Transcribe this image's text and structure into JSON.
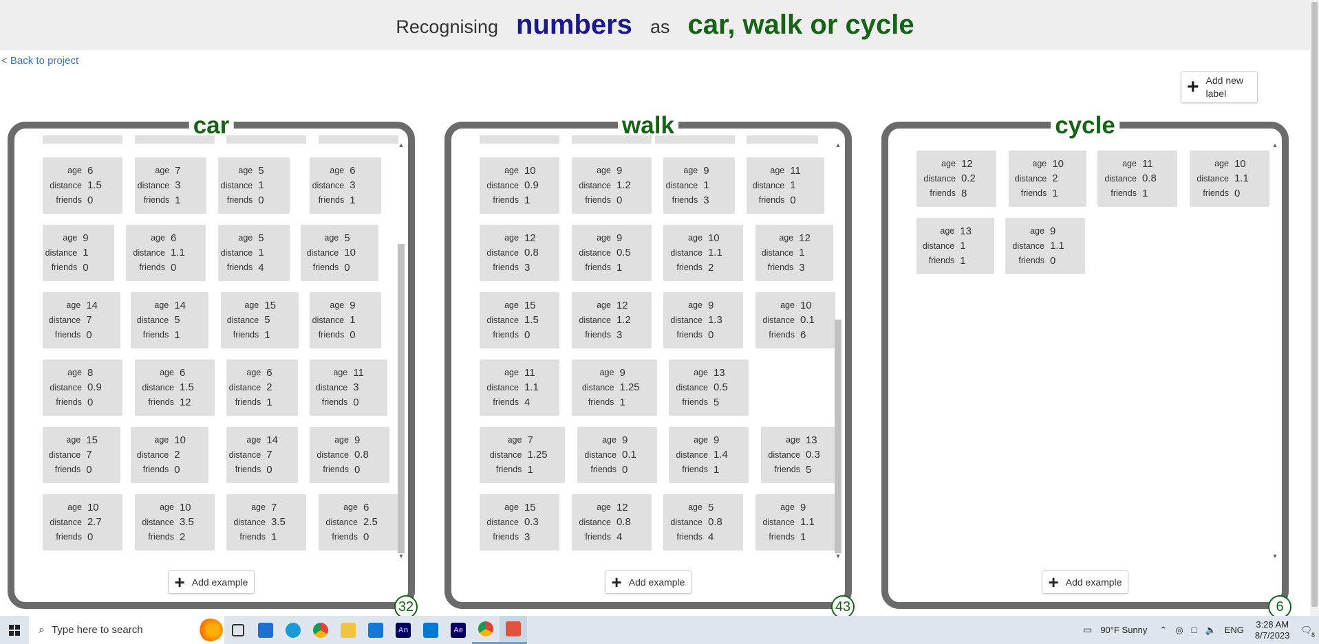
{
  "header": {
    "prefix": "Recognising",
    "type": "numbers",
    "middle": "as",
    "labels": "car, walk or cycle"
  },
  "back_link": "< Back to project",
  "add_label_button": {
    "line1": "Add new",
    "line2": "label"
  },
  "add_example_label": "Add example",
  "colors": {
    "title_green": "#166316",
    "title_blue": "#1a1a8c",
    "frame": "#6b6b6b",
    "card": "#e0e0e0"
  },
  "buckets": [
    {
      "name": "car",
      "count": "32",
      "cards": [
        [
          "6",
          "1.5",
          "0"
        ],
        [
          "7",
          "3",
          "1"
        ],
        [
          "5",
          "1",
          "0"
        ],
        [
          "6",
          "3",
          "1"
        ],
        [
          "9",
          "1",
          "0"
        ],
        [
          "6",
          "1.1",
          "0"
        ],
        [
          "5",
          "1",
          "4"
        ],
        [
          "5",
          "10",
          "0"
        ],
        [
          "14",
          "7",
          "0"
        ],
        [
          "14",
          "5",
          "1"
        ],
        [
          "15",
          "5",
          "1"
        ],
        [
          "9",
          "1",
          "0"
        ],
        [
          "8",
          "0.9",
          "0"
        ],
        [
          "6",
          "1.5",
          "12"
        ],
        [
          "6",
          "2",
          "1"
        ],
        [
          "11",
          "3",
          "0"
        ],
        [
          "15",
          "7",
          "0"
        ],
        [
          "10",
          "2",
          "0"
        ],
        [
          "14",
          "7",
          "0"
        ],
        [
          "9",
          "0.8",
          "0"
        ],
        [
          "10",
          "2.7",
          "0"
        ],
        [
          "10",
          "3.5",
          "2"
        ],
        [
          "7",
          "3.5",
          "1"
        ],
        [
          "6",
          "2.5",
          "0"
        ]
      ]
    },
    {
      "name": "walk",
      "count": "43",
      "cards": [
        [
          "10",
          "0.9",
          "1"
        ],
        [
          "9",
          "1.2",
          "0"
        ],
        [
          "9",
          "1",
          "3"
        ],
        [
          "11",
          "1",
          "0"
        ],
        [
          "12",
          "0.8",
          "3"
        ],
        [
          "9",
          "0.5",
          "1"
        ],
        [
          "10",
          "1.1",
          "2"
        ],
        [
          "12",
          "1",
          "3"
        ],
        [
          "15",
          "1.5",
          "0"
        ],
        [
          "12",
          "1.2",
          "3"
        ],
        [
          "9",
          "1.3",
          "0"
        ],
        [
          "10",
          "0.1",
          "6"
        ],
        [
          "11",
          "1.1",
          "4"
        ],
        [
          "9",
          "1.25",
          "1"
        ],
        [
          "13",
          "0.5",
          "5"
        ],
        [
          "7",
          "1.25",
          "1"
        ],
        [
          "9",
          "0.1",
          "0"
        ],
        [
          "9",
          "1.4",
          "1"
        ],
        [
          "13",
          "0.3",
          "5"
        ],
        [
          "15",
          "0.3",
          "3"
        ],
        [
          "12",
          "0.8",
          "4"
        ],
        [
          "5",
          "0.8",
          "4"
        ],
        [
          "9",
          "1.1",
          "1"
        ]
      ]
    },
    {
      "name": "cycle",
      "count": "6",
      "cards": [
        [
          "12",
          "0.2",
          "8"
        ],
        [
          "10",
          "2",
          "1"
        ],
        [
          "11",
          "0.8",
          "1"
        ],
        [
          "10",
          "1.1",
          "0"
        ],
        [
          "13",
          "1",
          "1"
        ],
        [
          "9",
          "1.1",
          "0"
        ]
      ]
    }
  ],
  "field_names": {
    "age": "age",
    "distance": "distance",
    "friends": "friends"
  },
  "taskbar": {
    "search_placeholder": "Type here to search",
    "weather": "90°F  Sunny",
    "lang": "ENG",
    "time": "3:28 AM",
    "date": "8/7/2023",
    "notification_count": "8"
  }
}
